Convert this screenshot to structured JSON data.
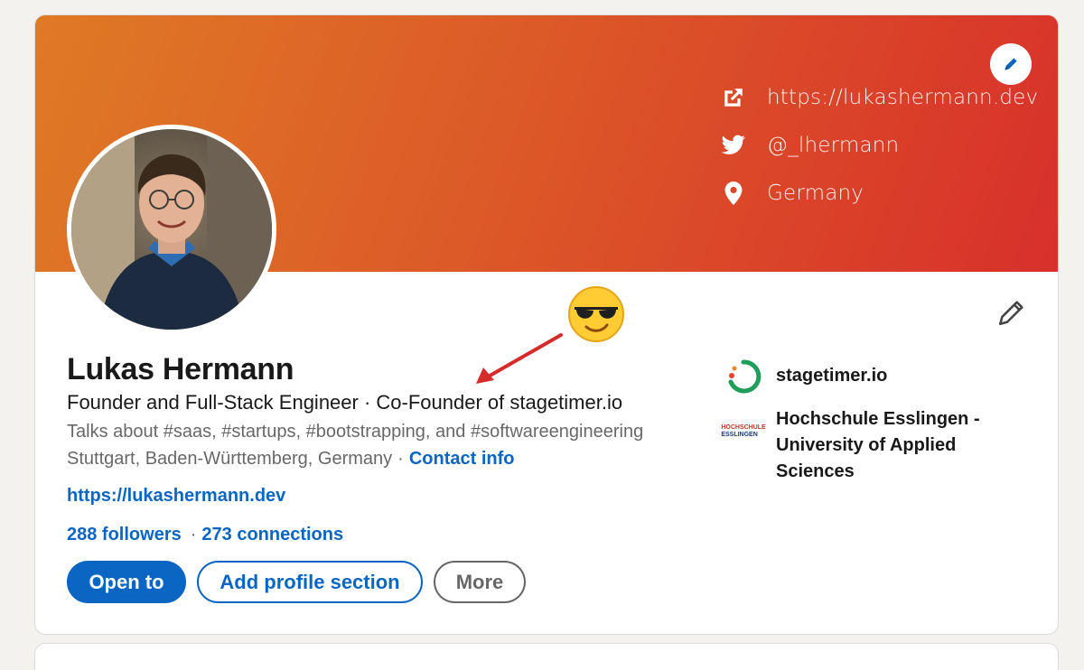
{
  "banner": {
    "website": "https://lukashermann.dev",
    "twitter": "@_lhermann",
    "location": "Germany",
    "gradient_start": "#df7a25",
    "gradient_end": "#d8302a",
    "icons": [
      "external-link-icon",
      "twitter-icon",
      "location-pin-icon"
    ]
  },
  "profile": {
    "name": "Lukas Hermann",
    "headline": "Founder and Full-Stack Engineer · Co-Founder of stagetimer.io",
    "talks_about": "Talks about #saas, #startups, #bootstrapping, and #softwareengineering",
    "location": "Stuttgart, Baden-Württemberg, Germany",
    "dot": "·",
    "contact_info": "Contact info",
    "website": "https://lukashermann.dev",
    "followers": "288 followers",
    "connections": "273 connections"
  },
  "actions": {
    "open_to": "Open to",
    "add_section": "Add profile section",
    "more": "More"
  },
  "sidebar": {
    "company": "stagetimer.io",
    "school": "Hochschule Esslingen - University of Applied Sciences",
    "school_logo_line1": "HOCHSCHULE",
    "school_logo_line2": "ESSLINGEN"
  },
  "colors": {
    "accent": "#0a66c2",
    "stagetimer_green": "#1e9e5a",
    "stagetimer_red": "#e8412c",
    "annotation_arrow": "#d62b2b"
  }
}
